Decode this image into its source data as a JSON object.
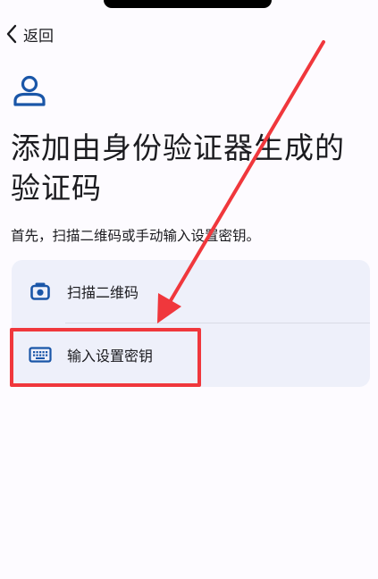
{
  "nav": {
    "back_label": "返回"
  },
  "header": {
    "title_line1": "添加由身份验证器生成的",
    "title_line2": "验证码",
    "subtitle": "首先，扫描二维码或手动输入设置密钥。"
  },
  "options": [
    {
      "label": "扫描二维码",
      "icon": "camera-icon"
    },
    {
      "label": "输入设置密钥",
      "icon": "keyboard-icon"
    }
  ],
  "colors": {
    "accent": "#1a56a8",
    "card_background": "#eef0fa",
    "annotation": "#f0373c"
  }
}
